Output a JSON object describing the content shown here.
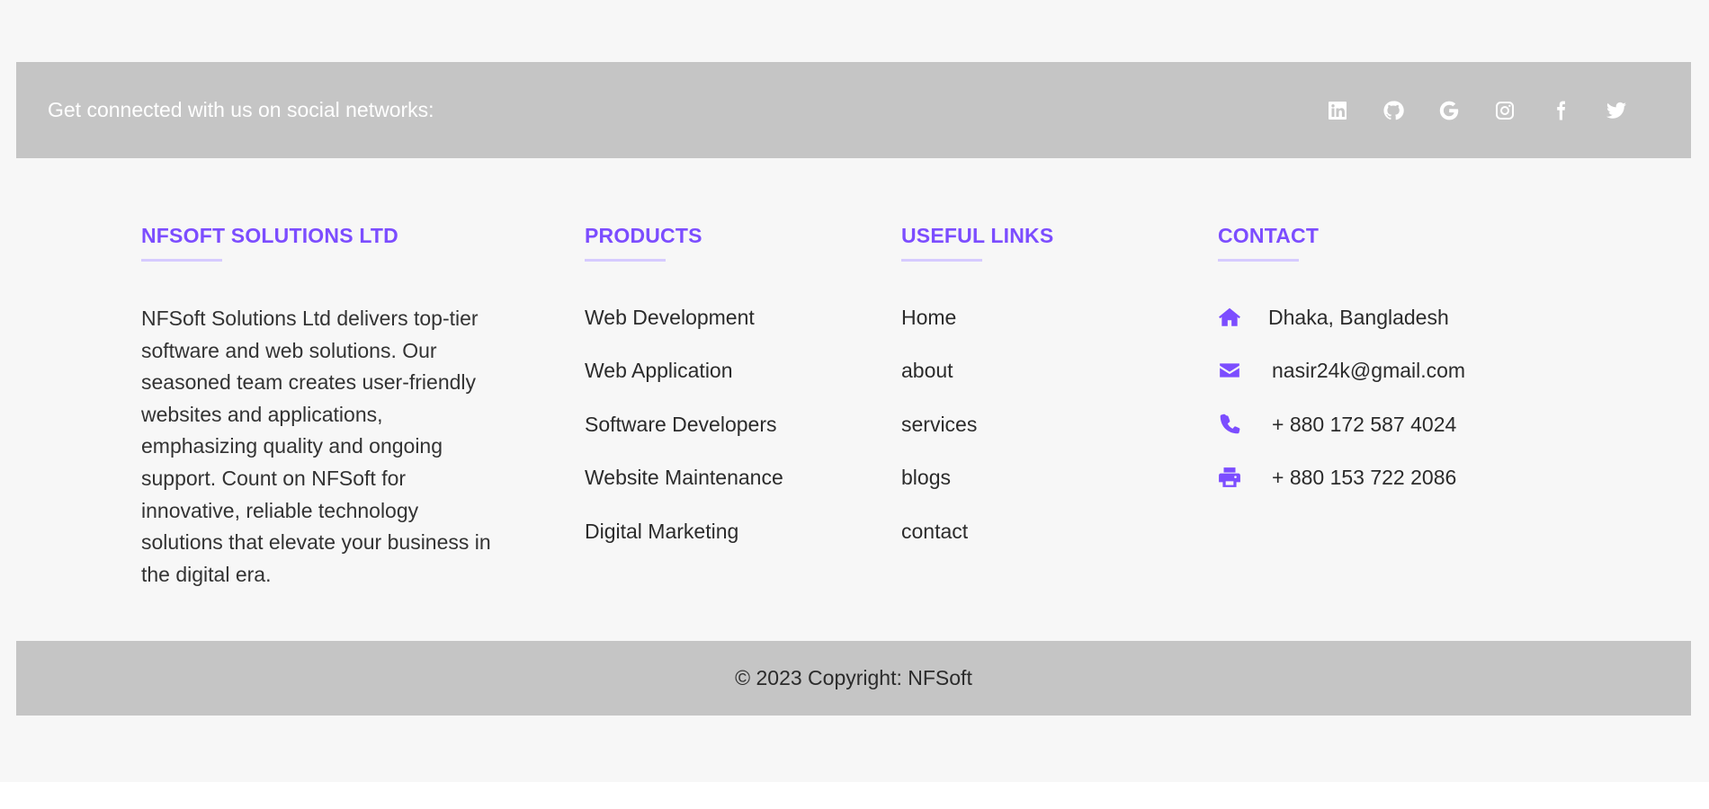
{
  "social": {
    "text": "Get connected with us on social networks:",
    "icons": [
      "linkedin-icon",
      "github-icon",
      "google-icon",
      "instagram-icon",
      "facebook-icon",
      "twitter-icon"
    ]
  },
  "company": {
    "title": "NFSOFT SOLUTIONS LTD",
    "description": "NFSoft Solutions Ltd delivers top-tier software and web solutions. Our seasoned team creates user-friendly websites and applications, emphasizing quality and ongoing support. Count on NFSoft for innovative, reliable technology solutions that elevate your business in the digital era."
  },
  "products": {
    "title": "PRODUCTS",
    "items": [
      "Web Development",
      "Web Application",
      "Software Developers",
      "Website Maintenance",
      "Digital Marketing"
    ]
  },
  "useful_links": {
    "title": "USEFUL LINKS",
    "items": [
      "Home",
      "about",
      "services",
      "blogs",
      "contact"
    ]
  },
  "contact": {
    "title": "CONTACT",
    "address": "Dhaka, Bangladesh",
    "email": "nasir24k@gmail.com",
    "phone": "+ 880 172 587 4024",
    "fax": "+ 880 153 722 2086"
  },
  "copyright": "© 2023 Copyright: NFSoft",
  "colors": {
    "accent": "#7c4dff",
    "bar_background": "#c5c5c5",
    "page_background": "#f7f7f7"
  }
}
